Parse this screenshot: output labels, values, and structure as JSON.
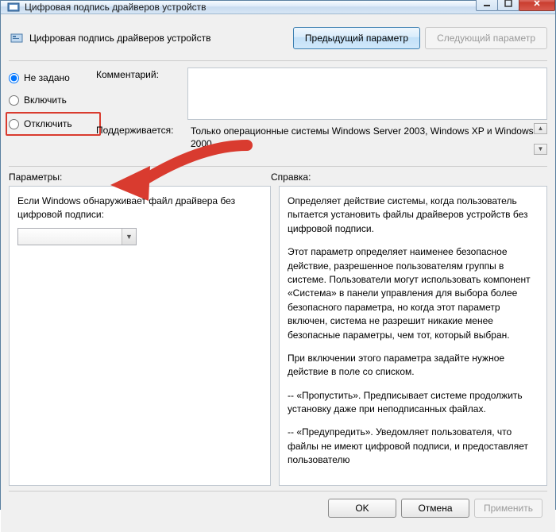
{
  "window": {
    "title": "Цифровая подпись драйверов устройств"
  },
  "header": {
    "title": "Цифровая подпись драйверов устройств",
    "prev": "Предыдущий параметр",
    "next": "Следующий параметр"
  },
  "radios": {
    "not_configured": "Не задано",
    "enable": "Включить",
    "disable": "Отключить"
  },
  "meta": {
    "comment_label": "Комментарий:",
    "comment_value": "",
    "supported_label": "Поддерживается:",
    "supported_value": "Только операционные системы Windows Server 2003, Windows XP и Windows 2000"
  },
  "labels": {
    "options": "Параметры:",
    "help": "Справка:"
  },
  "options": {
    "param_label": "Если Windows обнаруживает файл драйвера без цифровой подписи:",
    "combo_value": ""
  },
  "help": {
    "p1": "Определяет действие системы, когда пользователь пытается установить файлы драйверов устройств без цифровой подписи.",
    "p2": "Этот параметр определяет наименее безопасное действие, разрешенное пользователям группы в системе. Пользователи могут использовать компонент «Система» в панели управления для выбора более безопасного параметра, но когда этот параметр включен, система не разрешит никакие менее безопасные параметры, чем тот, который выбран.",
    "p3": "При включении этого параметра задайте нужное действие в поле со списком.",
    "p4": "--   «Пропустить». Предписывает системе продолжить установку даже при неподписанных файлах.",
    "p5": "--   «Предупредить». Уведомляет пользователя, что файлы не имеют цифровой подписи, и предоставляет пользователю"
  },
  "buttons": {
    "ok": "OK",
    "cancel": "Отмена",
    "apply": "Применить"
  }
}
